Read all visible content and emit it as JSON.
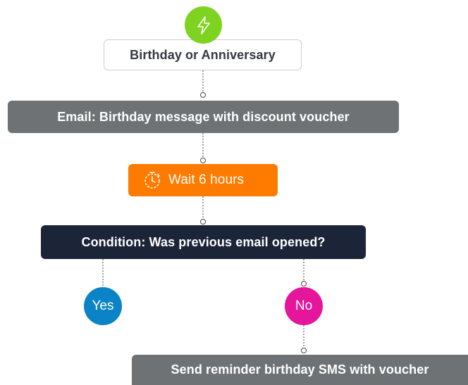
{
  "flow": {
    "trigger": {
      "icon": "lightning-bolt-icon",
      "label": "Birthday or Anniversary"
    },
    "email_step": {
      "label": "Email: Birthday message with discount voucher"
    },
    "wait_step": {
      "icon": "timer-icon",
      "label": "Wait 6 hours"
    },
    "condition_step": {
      "label": "Condition: Was previous email opened?"
    },
    "branches": {
      "yes": {
        "label": "Yes"
      },
      "no": {
        "label": "No"
      }
    },
    "sms_step": {
      "label": "Send reminder birthday SMS with voucher"
    }
  },
  "colors": {
    "trigger_icon_bg": "#7ed321",
    "email_bg": "#6f7275",
    "wait_bg": "#ff7b00",
    "condition_bg": "#1c2438",
    "yes_bg": "#0a84c6",
    "no_bg": "#e5169c",
    "sms_bg": "#6f7275"
  }
}
